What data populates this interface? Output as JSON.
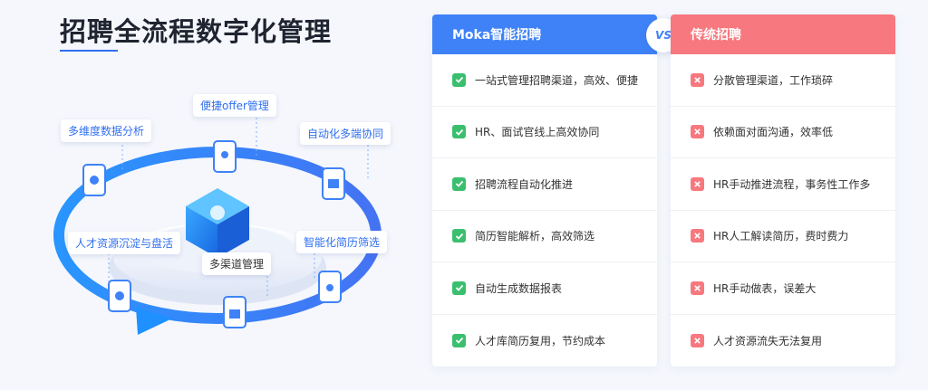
{
  "page": {
    "title": "招聘全流程数字化管理"
  },
  "illustration": {
    "labels": {
      "offer": "便捷offer管理",
      "analytics": "多维度数据分析",
      "multi_end": "自动化多端协同",
      "talent_pool": "人才资源沉淀与盘活",
      "resume_filter": "智能化简历筛选",
      "channels": "多渠道管理"
    }
  },
  "comparison": {
    "vs_label": "VS",
    "moka": {
      "title": "Moka智能招聘",
      "items": [
        "一站式管理招聘渠道，高效、便捷",
        "HR、面试官线上高效协同",
        "招聘流程自动化推进",
        "简历智能解析，高效筛选",
        "自动生成数据报表",
        "人才库简历复用，节约成本"
      ]
    },
    "traditional": {
      "title": "传统招聘",
      "items": [
        "分散管理渠道，工作琐碎",
        "依赖面对面沟通，效率低",
        "HR手动推进流程，事务性工作多",
        "HR人工解读简历，费时费力",
        "HR手动做表，误差大",
        "人才资源流失无法复用"
      ]
    }
  },
  "colors": {
    "accent": "#3f82f7",
    "negative": "#f7787e",
    "positive": "#3bbf6e"
  }
}
